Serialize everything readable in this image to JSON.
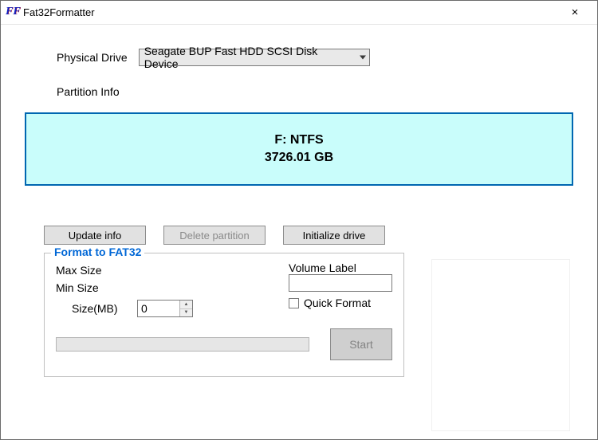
{
  "window": {
    "title": "Fat32Formatter",
    "close": "×"
  },
  "labels": {
    "physical_drive": "Physical Drive",
    "partition_info": "Partition Info",
    "max_size": "Max Size",
    "min_size": "Min Size",
    "size_mb": "Size(MB)",
    "volume_label": "Volume Label",
    "quick_format": "Quick Format",
    "group_title": "Format to FAT32"
  },
  "drive": {
    "selected": "Seagate BUP Fast HDD SCSI Disk Device"
  },
  "partition": {
    "name": "F: NTFS",
    "size": "3726.01 GB"
  },
  "buttons": {
    "update_info": "Update info",
    "delete_partition": "Delete partition",
    "initialize_drive": "Initialize drive",
    "start": "Start"
  },
  "form": {
    "size_value": "0",
    "volume_label_value": ""
  }
}
